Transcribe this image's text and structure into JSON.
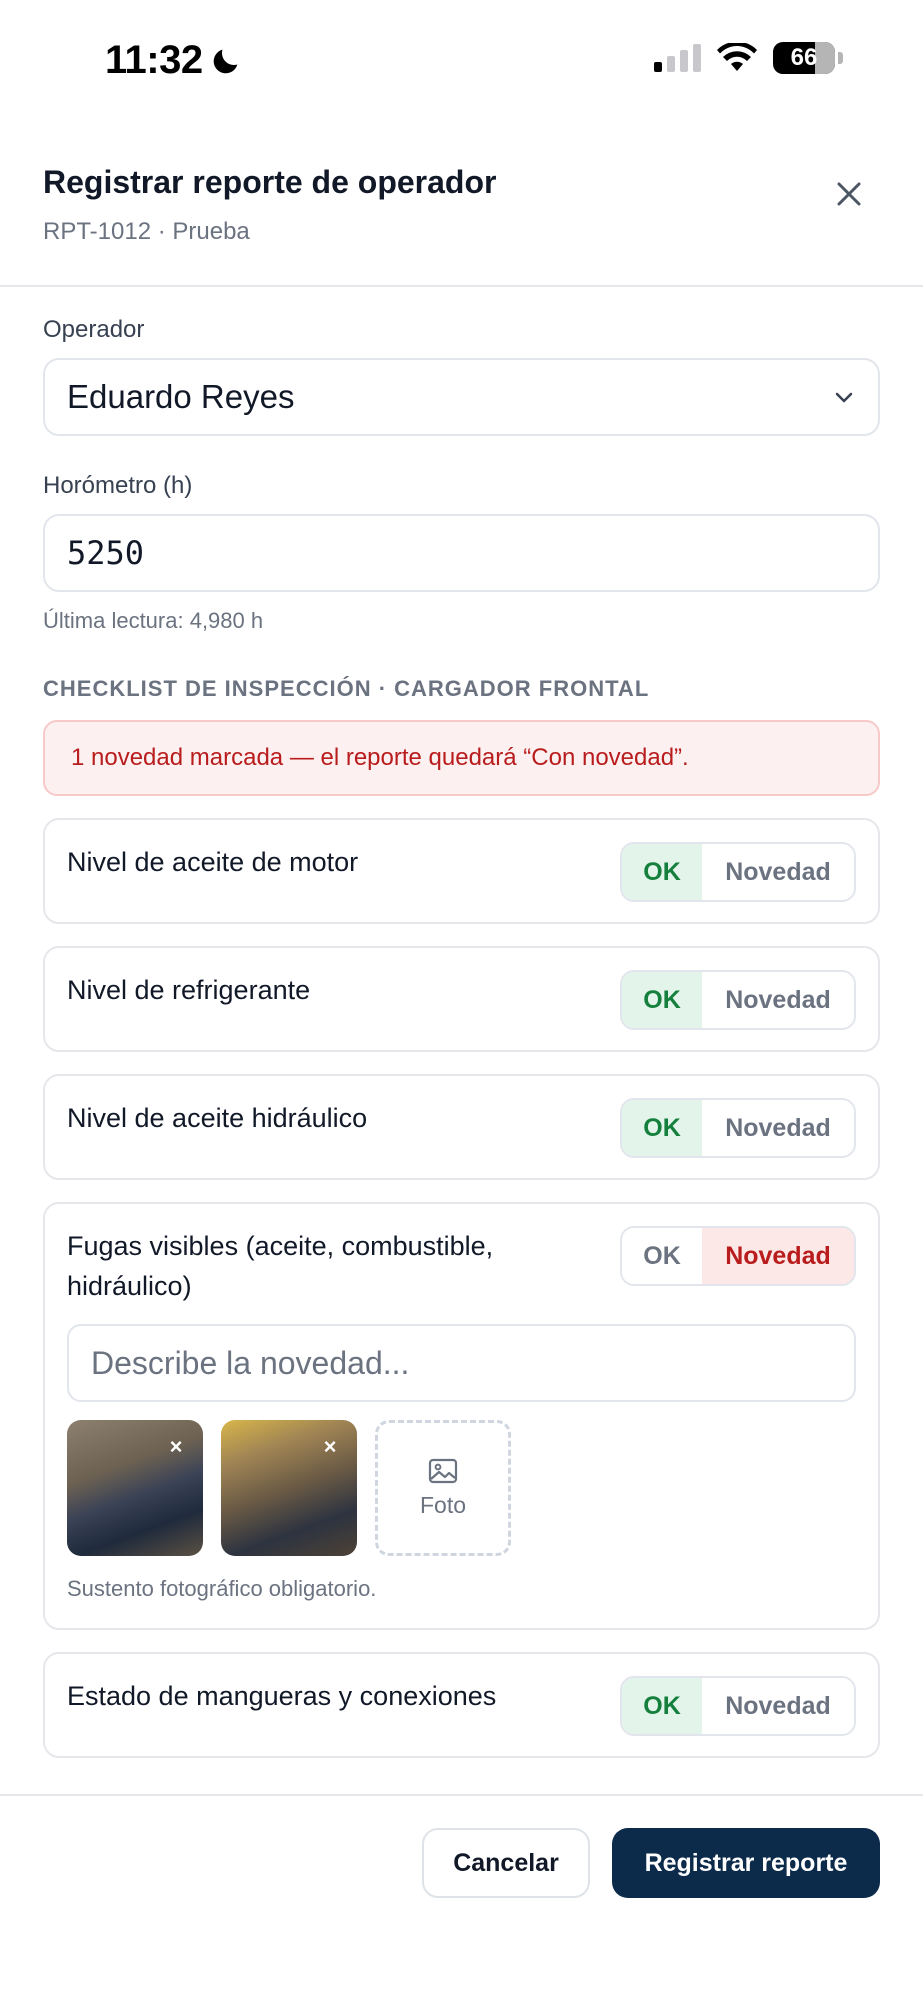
{
  "status_bar": {
    "time": "11:32",
    "battery": "66",
    "moon_icon": "moon-icon",
    "signal_icon": "cellular-signal-icon",
    "wifi_icon": "wifi-icon"
  },
  "header": {
    "title": "Registrar reporte de operador",
    "subtitle": "RPT-1012 · Prueba",
    "close_icon": "close-icon"
  },
  "operator": {
    "label": "Operador",
    "value": "Eduardo Reyes",
    "icon": "chevron-down-icon"
  },
  "hourmeter": {
    "label": "Horómetro (h)",
    "value": "5250",
    "hint": "Última lectura: 4,980 h"
  },
  "checklist": {
    "title": "CHECKLIST DE INSPECCIÓN · CARGADOR FRONTAL",
    "alert": "1 novedad marcada — el reporte quedará “Con novedad”.",
    "ok_label": "OK",
    "issue_label": "Novedad",
    "items": [
      {
        "label": "Nivel de aceite de motor",
        "status": "OK"
      },
      {
        "label": "Nivel de refrigerante",
        "status": "OK"
      },
      {
        "label": "Nivel de aceite hidráulico",
        "status": "OK"
      },
      {
        "label": "Fugas visibles (aceite, combustible, hidráulico)",
        "status": "Novedad",
        "description_placeholder": "Describe la novedad...",
        "photo_add_label": "Foto",
        "photo_hint": "Sustento fotográfico obligatorio.",
        "remove_label": "×"
      },
      {
        "label": "Estado de mangueras y conexiones",
        "status": "OK"
      }
    ]
  },
  "footer": {
    "cancel": "Cancelar",
    "submit": "Registrar reporte"
  },
  "colors": {
    "primary": "#0c2a4a",
    "ok_bg": "#e3f4ea",
    "ok_text": "#15803d",
    "issue_bg": "#fde8e8",
    "issue_text": "#b91c1c"
  }
}
